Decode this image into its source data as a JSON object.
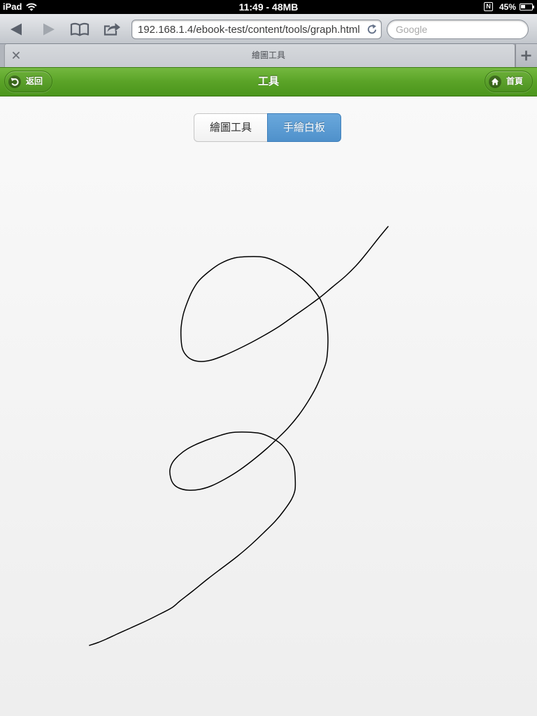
{
  "status_bar": {
    "device": "iPad",
    "time": "11:49 - 48MB",
    "indicator": "N",
    "battery_percent_label": "45%",
    "battery_level": 0.45,
    "wifi_icon": "wifi-icon",
    "battery_icon": "battery-icon"
  },
  "browser": {
    "toolbar": {
      "back_icon": "back-arrow-icon",
      "forward_icon": "forward-arrow-icon",
      "forward_enabled": false,
      "bookmarks_icon": "open-book-icon",
      "share_icon": "share-icon"
    },
    "address_bar": {
      "url": "192.168.1.4/ebook-test/content/tools/graph.html",
      "reload_icon": "reload-icon"
    },
    "search": {
      "placeholder": "Google",
      "value": ""
    },
    "tabs": [
      {
        "title": "繪圖工具",
        "active": true,
        "close_icon": "close-icon"
      }
    ],
    "new_tab_icon": "plus-icon"
  },
  "header": {
    "title": "工具",
    "color": "#5da42a",
    "back_button": {
      "label": "返回",
      "icon": "back-circle-icon"
    },
    "home_button": {
      "label": "首頁",
      "icon": "home-icon"
    }
  },
  "segmented_control": {
    "options": [
      "繪圖工具",
      "手繪白板"
    ],
    "selected_index": 1,
    "selected_color": "#5a9fd4"
  },
  "whiteboard": {
    "stroke_color": "#000000"
  }
}
